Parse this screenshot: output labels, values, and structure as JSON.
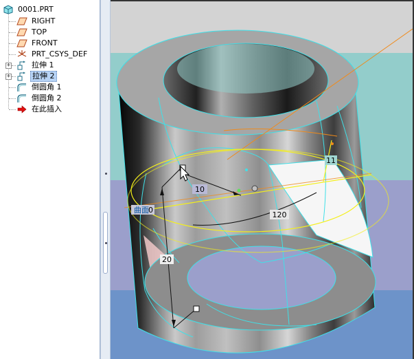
{
  "model_tree": {
    "root": "0001.PRT",
    "items": [
      {
        "label": "RIGHT",
        "icon": "datum-plane-icon"
      },
      {
        "label": "TOP",
        "icon": "datum-plane-icon"
      },
      {
        "label": "FRONT",
        "icon": "datum-plane-icon"
      },
      {
        "label": "PRT_CSYS_DEF",
        "icon": "coordinate-system-icon"
      },
      {
        "label": "拉伸 1",
        "icon": "extrude-icon"
      },
      {
        "label": "拉伸 2",
        "icon": "extrude-icon",
        "selected": true
      },
      {
        "label": "倒圆角 1",
        "icon": "round-icon"
      },
      {
        "label": "倒圆角 2",
        "icon": "round-icon"
      },
      {
        "label": "在此插入",
        "icon": "insert-here-arrow-icon"
      }
    ]
  },
  "viewport": {
    "dimensions": {
      "d1": "10",
      "d2": "120",
      "d3": "20",
      "d4": "0",
      "d5": "11"
    },
    "surface_label": "曲面"
  },
  "colors": {
    "background_bands": [
      "#d3d3d3",
      "#93cdcb",
      "#9b9fcb",
      "#6d93c9"
    ],
    "model_gray": "#a6a6a6",
    "edge_cyan": "#3fe0e8",
    "selection_yellow": "#f4ef1a",
    "tree_selection": "#b7d3f5"
  }
}
